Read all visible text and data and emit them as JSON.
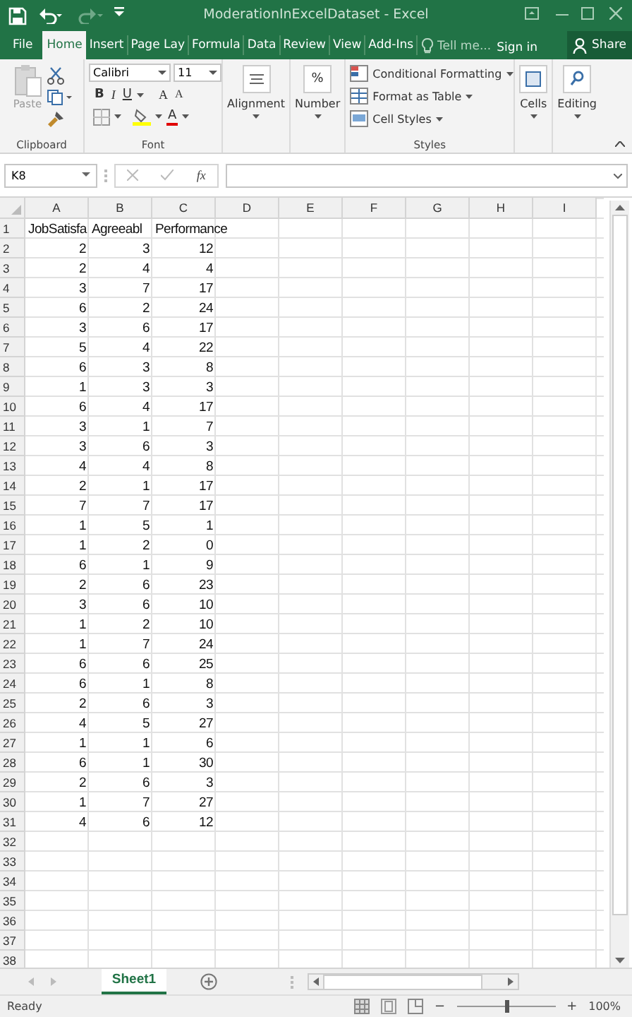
{
  "window": {
    "title": "ModerationInExcelDataset - Excel"
  },
  "tabs": [
    {
      "label": "File",
      "selected": false
    },
    {
      "label": "Home",
      "selected": true
    },
    {
      "label": "Insert",
      "selected": false
    },
    {
      "label": "Page Lay",
      "selected": false
    },
    {
      "label": "Formula",
      "selected": false
    },
    {
      "label": "Data",
      "selected": false
    },
    {
      "label": "Review",
      "selected": false
    },
    {
      "label": "View",
      "selected": false
    },
    {
      "label": "Add-Ins",
      "selected": false
    }
  ],
  "tell_me": "Tell me...",
  "sign_in": "Sign in",
  "share": "Share",
  "ribbon": {
    "paste": "Paste",
    "clipboard_label": "Clipboard",
    "font_name": "Calibri",
    "font_size": "11",
    "bold": "B",
    "italic": "I",
    "underline": "U",
    "grow": "A",
    "shrink": "A",
    "font_color": "A",
    "font_label": "Font",
    "alignment": "Alignment",
    "number": "Number",
    "number_glyph": "%",
    "conditional": "Conditional Formatting",
    "format_table": "Format as Table",
    "cell_styles": "Cell Styles",
    "styles_label": "Styles",
    "cells": "Cells",
    "editing": "Editing"
  },
  "formula_bar": {
    "name_box": "K8",
    "function_label": "fx"
  },
  "columns": [
    "A",
    "B",
    "C",
    "D",
    "E",
    "F",
    "G",
    "H",
    "I"
  ],
  "rows": [
    {
      "number": "1",
      "cells": [
        "JobSatisfa",
        "Agreeabl",
        "Performance"
      ]
    },
    {
      "number": "2",
      "cells": [
        "2",
        "3",
        "12"
      ]
    },
    {
      "number": "3",
      "cells": [
        "2",
        "4",
        "4"
      ]
    },
    {
      "number": "4",
      "cells": [
        "3",
        "7",
        "17"
      ]
    },
    {
      "number": "5",
      "cells": [
        "6",
        "2",
        "24"
      ]
    },
    {
      "number": "6",
      "cells": [
        "3",
        "6",
        "17"
      ]
    },
    {
      "number": "7",
      "cells": [
        "5",
        "4",
        "22"
      ]
    },
    {
      "number": "8",
      "cells": [
        "6",
        "3",
        "8"
      ]
    },
    {
      "number": "9",
      "cells": [
        "1",
        "3",
        "3"
      ]
    },
    {
      "number": "10",
      "cells": [
        "6",
        "4",
        "17"
      ]
    },
    {
      "number": "11",
      "cells": [
        "3",
        "1",
        "7"
      ]
    },
    {
      "number": "12",
      "cells": [
        "3",
        "6",
        "3"
      ]
    },
    {
      "number": "13",
      "cells": [
        "4",
        "4",
        "8"
      ]
    },
    {
      "number": "14",
      "cells": [
        "2",
        "1",
        "17"
      ]
    },
    {
      "number": "15",
      "cells": [
        "7",
        "7",
        "17"
      ]
    },
    {
      "number": "16",
      "cells": [
        "1",
        "5",
        "1"
      ]
    },
    {
      "number": "17",
      "cells": [
        "1",
        "2",
        "0"
      ]
    },
    {
      "number": "18",
      "cells": [
        "6",
        "1",
        "9"
      ]
    },
    {
      "number": "19",
      "cells": [
        "2",
        "6",
        "23"
      ]
    },
    {
      "number": "20",
      "cells": [
        "3",
        "6",
        "10"
      ]
    },
    {
      "number": "21",
      "cells": [
        "1",
        "2",
        "10"
      ]
    },
    {
      "number": "22",
      "cells": [
        "1",
        "7",
        "24"
      ]
    },
    {
      "number": "23",
      "cells": [
        "6",
        "6",
        "25"
      ]
    },
    {
      "number": "24",
      "cells": [
        "6",
        "1",
        "8"
      ]
    },
    {
      "number": "25",
      "cells": [
        "2",
        "6",
        "3"
      ]
    },
    {
      "number": "26",
      "cells": [
        "4",
        "5",
        "27"
      ]
    },
    {
      "number": "27",
      "cells": [
        "1",
        "1",
        "6"
      ]
    },
    {
      "number": "28",
      "cells": [
        "6",
        "1",
        "30"
      ]
    },
    {
      "number": "29",
      "cells": [
        "2",
        "6",
        "3"
      ]
    },
    {
      "number": "30",
      "cells": [
        "1",
        "7",
        "27"
      ]
    },
    {
      "number": "31",
      "cells": [
        "4",
        "6",
        "12"
      ]
    },
    {
      "number": "32",
      "cells": []
    },
    {
      "number": "33",
      "cells": []
    },
    {
      "number": "34",
      "cells": []
    },
    {
      "number": "35",
      "cells": []
    },
    {
      "number": "36",
      "cells": []
    },
    {
      "number": "37",
      "cells": []
    },
    {
      "number": "38",
      "cells": []
    }
  ],
  "sheets": [
    {
      "label": "Sheet1",
      "selected": true
    }
  ],
  "status": {
    "text": "Ready",
    "zoom_out": "−",
    "zoom_in": "+",
    "zoom": "100%",
    "level": 0.5
  }
}
